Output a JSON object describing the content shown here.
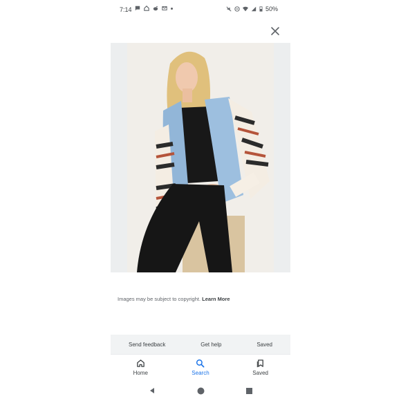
{
  "status_bar": {
    "time": "7:14",
    "battery": "50%",
    "left_icons": [
      "chat-icon",
      "home-icon",
      "reddit-icon",
      "gmail-icon",
      "dot-icon"
    ],
    "right_icons": [
      "mute-icon",
      "dnd-icon",
      "wifi-icon",
      "signal-icon",
      "battery-icon"
    ]
  },
  "viewer": {
    "close_icon": "close-icon",
    "image_alt": "Woman wearing denim vest over patterned knit sweater"
  },
  "copyright": {
    "text": "Images may be subject to copyright.",
    "link": "Learn More"
  },
  "feedback_bar": {
    "send_feedback": "Send feedback",
    "get_help": "Get help",
    "saved": "Saved"
  },
  "bottom_nav": {
    "items": [
      {
        "label": "Home",
        "icon": "home-icon"
      },
      {
        "label": "Search",
        "icon": "search-icon"
      },
      {
        "label": "Saved",
        "icon": "bookmarks-icon"
      }
    ],
    "active": "Search"
  },
  "colors": {
    "accent": "#1a73e8",
    "feedback_bg": "#f1f3f4",
    "image_bg": "#eceeef"
  }
}
